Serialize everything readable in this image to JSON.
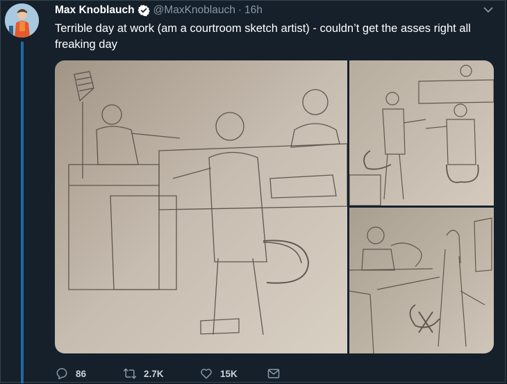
{
  "tweet": {
    "display_name": "Max Knoblauch",
    "handle": "@MaxKnoblauch",
    "separator": "·",
    "time": "16h",
    "text": "Terrible day at work (am a courtroom sketch artist) - couldn’t get the asses right all freaking day"
  },
  "actions": {
    "replies": "86",
    "retweets": "2.7K",
    "likes": "15K"
  },
  "media": {
    "image_count": 3
  },
  "colors": {
    "background": "#15202b",
    "secondary_text": "#8899a6",
    "thread_line": "#1d6aa4",
    "verified": "#ffffff"
  },
  "icons": [
    "verified-icon",
    "caret-down-icon",
    "reply-icon",
    "retweet-icon",
    "like-icon",
    "share-icon"
  ]
}
